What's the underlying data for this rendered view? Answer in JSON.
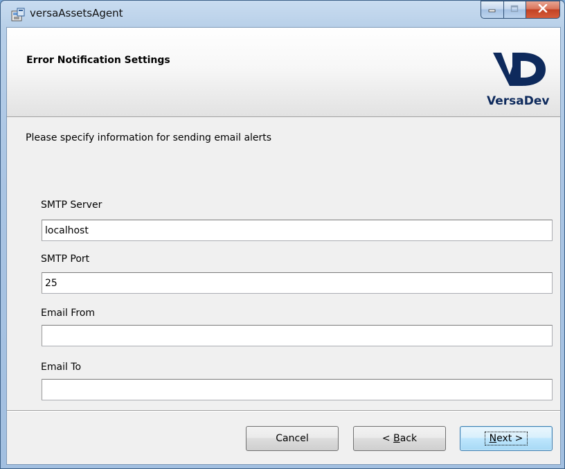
{
  "window": {
    "title": "versaAssetsAgent",
    "icons": {
      "app": "installer-icon",
      "minimize": "minimize-icon",
      "maximize": "maximize-icon",
      "close": "close-icon"
    }
  },
  "banner": {
    "title": "Error Notification Settings",
    "logo_text": "VersaDev",
    "logo_color": "#0e2a5c"
  },
  "description": "Please specify information for sending email alerts",
  "fields": {
    "smtp_server": {
      "label": "SMTP Server",
      "value": "localhost"
    },
    "smtp_port": {
      "label": "SMTP Port",
      "value": "25"
    },
    "email_from": {
      "label": "Email From",
      "value": ""
    },
    "email_to": {
      "label": "Email To",
      "value": ""
    }
  },
  "buttons": {
    "cancel": "Cancel",
    "back_prefix": "< ",
    "back_accel": "B",
    "back_rest": "ack",
    "next_accel": "N",
    "next_rest": "ext >"
  },
  "colors": {
    "close_button": "#c24224",
    "default_button_border": "#3c7fb1"
  }
}
